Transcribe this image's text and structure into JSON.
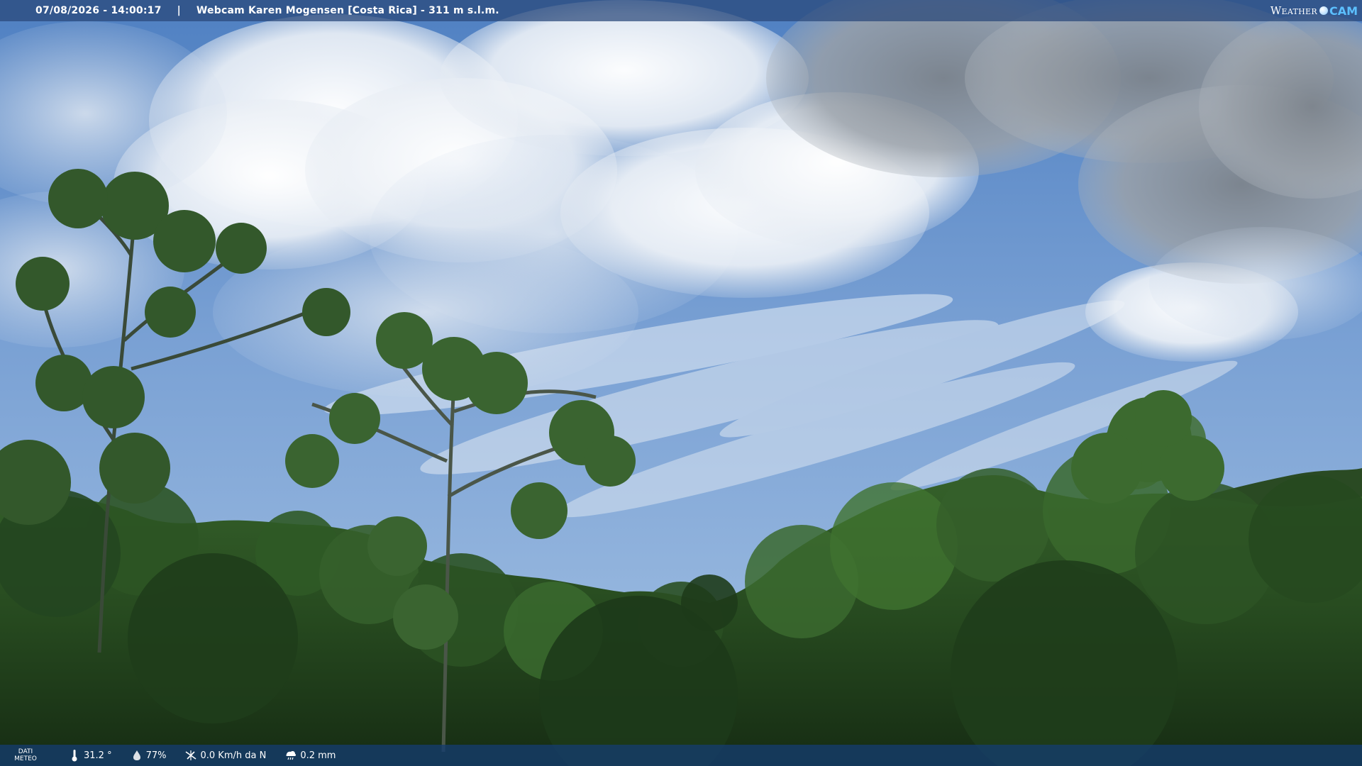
{
  "header": {
    "timestamp": "07/08/2026 - 14:00:17",
    "separator": "|",
    "title": "Webcam Karen Mogensen [Costa Rica] - 311 m s.l.m."
  },
  "logo": {
    "weather": "Weather",
    "cam": "CAM"
  },
  "footer": {
    "label_line1": "DATI",
    "label_line2": "METEO",
    "temperature": "31.2 °",
    "humidity": "77%",
    "wind": "0.0 Km/h da N",
    "rain": "0.2 mm"
  },
  "icons": {
    "temperature": "thermometer-icon",
    "humidity": "droplet-icon",
    "wind": "wind-icon",
    "rain": "rain-icon",
    "logo_dot": "globe-icon"
  },
  "colors": {
    "sky_top": "#5b8ccc",
    "sky_mid": "#7ea3d6",
    "sky_low": "#8fb2dc",
    "cloud_white": "#f2f4f7",
    "cloud_gray": "#8d949c",
    "forest_dark": "#1f3a1c",
    "forest_mid": "#2f5a26",
    "forest_light": "#4d7b37",
    "logo_cam": "#5cc0ff"
  }
}
